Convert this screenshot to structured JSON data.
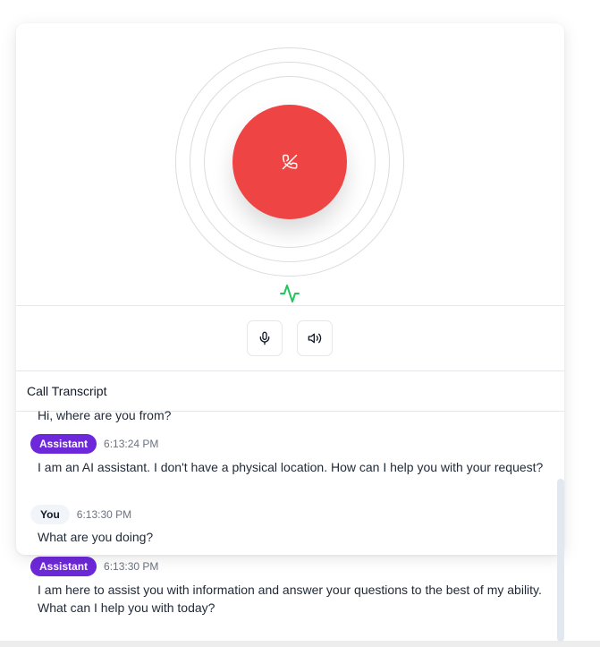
{
  "controls": {
    "end_call_icon": "phone-off-icon",
    "activity_icon": "activity-icon",
    "mic_icon": "microphone-icon",
    "speaker_icon": "speaker-icon"
  },
  "colors": {
    "end_call": "#ef4444",
    "activity": "#22c55e",
    "assistant_badge": "#6d28d9",
    "you_badge": "#f1f5f9"
  },
  "transcript": {
    "title": "Call Transcript",
    "messages": [
      {
        "speaker": "",
        "time": "",
        "text": "Hi, where are you from?"
      },
      {
        "speaker": "Assistant",
        "time": "6:13:24 PM",
        "text": "I am an AI assistant. I don't have a physical location. How can I help you with your request?"
      },
      {
        "speaker": "You",
        "time": "6:13:30 PM",
        "text": "What are you doing?"
      },
      {
        "speaker": "Assistant",
        "time": "6:13:30 PM",
        "text": "I am here to assist you with information and answer your questions to the best of my ability. What can I help you with today?"
      }
    ]
  }
}
